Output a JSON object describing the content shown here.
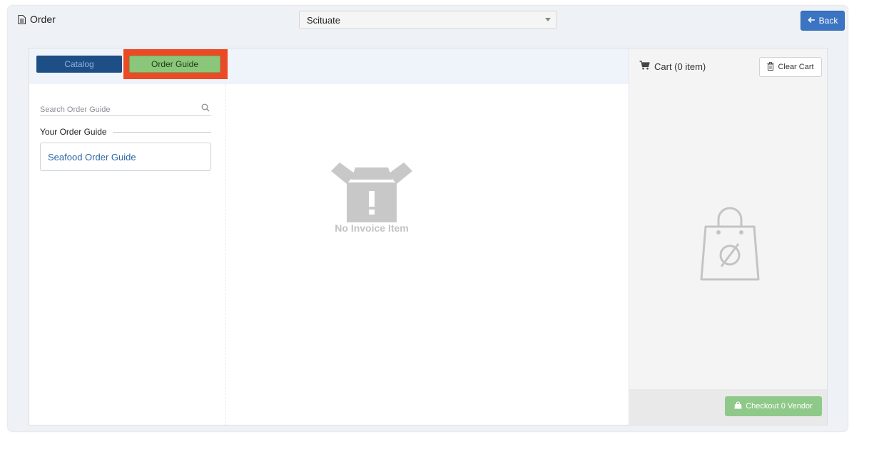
{
  "header": {
    "title": "Order",
    "title_icon": "document-icon",
    "location_select": {
      "value": "Scituate"
    },
    "back_button": {
      "label": "Back",
      "icon": "arrow-left-icon"
    }
  },
  "tabs": [
    {
      "label": "Catalog",
      "active": false
    },
    {
      "label": "Order Guide",
      "active": true,
      "highlighted": true
    }
  ],
  "sidebar": {
    "search": {
      "placeholder": "Search Order Guide",
      "value": ""
    },
    "section_heading": "Your Order Guide",
    "items": [
      {
        "label": "Seafood Order Guide"
      }
    ]
  },
  "main": {
    "empty_message": "No Invoice Item",
    "empty_icon": "open-box-alert-icon"
  },
  "cart": {
    "title": "Cart (0 item)",
    "cart_icon": "cart-icon",
    "clear_button": {
      "label": "Clear Cart",
      "icon": "trash-icon"
    },
    "empty_icon": "empty-bag-icon",
    "checkout_button": {
      "label": "Checkout 0 Vendor",
      "icon": "bag-icon"
    }
  },
  "colors": {
    "accent_blue": "#3a74c2",
    "catalog_tab": "#1d4e85",
    "order_guide_tab": "#8bc77a",
    "highlight": "#ec4a24",
    "checkout_green": "#8fc98a"
  }
}
